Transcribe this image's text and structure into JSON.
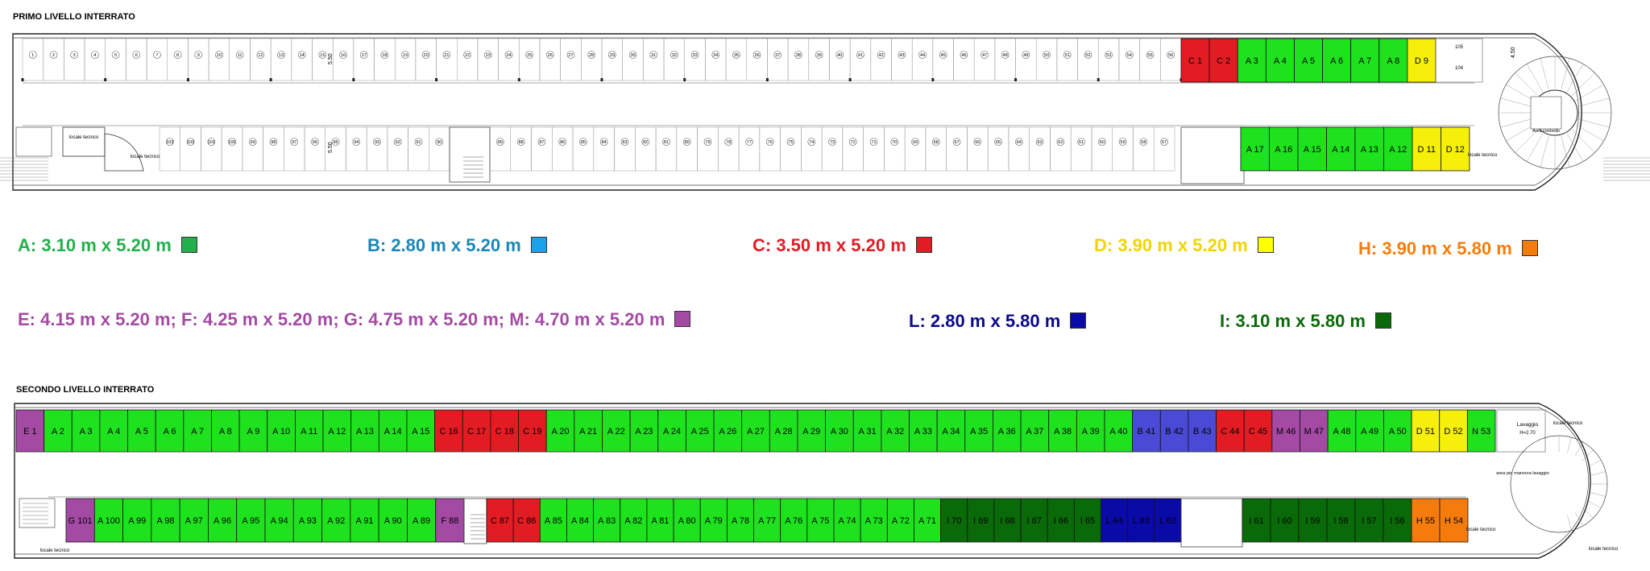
{
  "levels": {
    "first": {
      "title": "PRIMO LIVELLO INTERRATO"
    },
    "second": {
      "title": "SECONDO LIVELLO INTERRATO"
    }
  },
  "colors": {
    "A": "#1fe21f",
    "B": "#4a4ad6",
    "C": "#e31b23",
    "D": "#f5ef0a",
    "H": "#f57c0c",
    "M": "#a44aa4",
    "L": "#0a0aa6",
    "I": "#0a6a0a"
  },
  "legend": {
    "row1": [
      {
        "text": "A:  3.10 m  x  5.20 m",
        "color": "#22b04c",
        "swatch": "#22b04c"
      },
      {
        "text": "B:  2.80 m  x   5.20 m",
        "color": "#1a86b8",
        "swatch": "#1aa3e8"
      },
      {
        "text": "C:  3.50 m  x  5.20 m",
        "color": "#e31b23",
        "swatch": "#e31b23"
      },
      {
        "text": "D:  3.90 m x 5.20 m",
        "color": "#f2d400",
        "swatch": "#ffff00"
      },
      {
        "text": "H: 3.90 m  x  5.80 m",
        "color": "#f57c0c",
        "swatch": "#f57c0c"
      }
    ],
    "row2": [
      {
        "text": "E:  4.15 m  x  5.20 m;  F: 4.25 m  x  5.20 m;  G:  4.75 m  x  5.20 m;  M:  4.70 m  x  5.20 m",
        "color": "#a44aa4",
        "swatch": "#a44aa4"
      },
      {
        "text": "L:  2.80 m  x  5.80 m",
        "color": "#0a0a8a",
        "swatch": "#0a0aa6"
      },
      {
        "text": "I:  3.10 m  x  5.80 m",
        "color": "#0a6a0a",
        "swatch": "#0a6a0a"
      }
    ]
  },
  "level1": {
    "top_numbers": [
      "1",
      "2",
      "3",
      "4",
      "5",
      "6",
      "7",
      "8",
      "9",
      "10",
      "11",
      "12",
      "13",
      "14",
      "15",
      "16",
      "17",
      "18",
      "19",
      "20",
      "21",
      "22",
      "23",
      "24",
      "25",
      "26",
      "27",
      "28",
      "29",
      "30",
      "31",
      "32",
      "33",
      "34",
      "35",
      "36",
      "37",
      "38",
      "39",
      "40",
      "41",
      "42",
      "43",
      "44",
      "45",
      "46",
      "47",
      "48",
      "49",
      "50",
      "51",
      "52",
      "53",
      "54",
      "55",
      "56"
    ],
    "bottom_left_numbers": [
      "103",
      "102",
      "101",
      "100",
      "99",
      "98",
      "97",
      "96",
      "95",
      "94",
      "93",
      "92",
      "91",
      "90"
    ],
    "bottom_right_numbers": [
      "89",
      "88",
      "87",
      "86",
      "85",
      "84",
      "83",
      "82",
      "81",
      "80",
      "79",
      "78",
      "77",
      "76",
      "75",
      "74",
      "73",
      "72",
      "71",
      "70",
      "69",
      "68",
      "67",
      "66",
      "65",
      "64",
      "63",
      "62",
      "61",
      "60",
      "59",
      "58",
      "57"
    ],
    "top_colored": [
      {
        "label": "C 1",
        "type": "C"
      },
      {
        "label": "C 2",
        "type": "C"
      },
      {
        "label": "A 3",
        "type": "A"
      },
      {
        "label": "A 4",
        "type": "A"
      },
      {
        "label": "A 5",
        "type": "A"
      },
      {
        "label": "A 6",
        "type": "A"
      },
      {
        "label": "A 7",
        "type": "A"
      },
      {
        "label": "A 8",
        "type": "A"
      },
      {
        "label": "D 9",
        "type": "D"
      }
    ],
    "bottom_colored": [
      {
        "label": "A 17",
        "type": "A"
      },
      {
        "label": "A 16",
        "type": "A"
      },
      {
        "label": "A 15",
        "type": "A"
      },
      {
        "label": "A 14",
        "type": "A"
      },
      {
        "label": "A 13",
        "type": "A"
      },
      {
        "label": "A 12",
        "type": "A"
      },
      {
        "label": "D 11",
        "type": "D"
      },
      {
        "label": "D 12",
        "type": "D"
      }
    ],
    "locale_tecnico": "locale tecnico",
    "area_controllo": "Area controllo",
    "dim_small": "5.50",
    "dim_ramp": "4.50",
    "small_rooms": [
      "105",
      "104"
    ]
  },
  "level2": {
    "top": [
      {
        "label": "E 1",
        "type": "M"
      },
      {
        "label": "A 2",
        "type": "A"
      },
      {
        "label": "A 3",
        "type": "A"
      },
      {
        "label": "A 4",
        "type": "A"
      },
      {
        "label": "A 5",
        "type": "A"
      },
      {
        "label": "A 6",
        "type": "A"
      },
      {
        "label": "A 7",
        "type": "A"
      },
      {
        "label": "A 8",
        "type": "A"
      },
      {
        "label": "A 9",
        "type": "A"
      },
      {
        "label": "A 10",
        "type": "A"
      },
      {
        "label": "A 11",
        "type": "A"
      },
      {
        "label": "A 12",
        "type": "A"
      },
      {
        "label": "A 13",
        "type": "A"
      },
      {
        "label": "A 14",
        "type": "A"
      },
      {
        "label": "A 15",
        "type": "A"
      },
      {
        "label": "C 16",
        "type": "C"
      },
      {
        "label": "C 17",
        "type": "C"
      },
      {
        "label": "C 18",
        "type": "C"
      },
      {
        "label": "C 19",
        "type": "C"
      },
      {
        "label": "A 20",
        "type": "A"
      },
      {
        "label": "A 21",
        "type": "A"
      },
      {
        "label": "A 22",
        "type": "A"
      },
      {
        "label": "A 23",
        "type": "A"
      },
      {
        "label": "A 24",
        "type": "A"
      },
      {
        "label": "A 25",
        "type": "A"
      },
      {
        "label": "A 26",
        "type": "A"
      },
      {
        "label": "A 27",
        "type": "A"
      },
      {
        "label": "A 28",
        "type": "A"
      },
      {
        "label": "A 29",
        "type": "A"
      },
      {
        "label": "A 30",
        "type": "A"
      },
      {
        "label": "A 31",
        "type": "A"
      },
      {
        "label": "A 32",
        "type": "A"
      },
      {
        "label": "A 33",
        "type": "A"
      },
      {
        "label": "A 34",
        "type": "A"
      },
      {
        "label": "A 35",
        "type": "A"
      },
      {
        "label": "A 36",
        "type": "A"
      },
      {
        "label": "A 37",
        "type": "A"
      },
      {
        "label": "A 38",
        "type": "A"
      },
      {
        "label": "A 39",
        "type": "A"
      },
      {
        "label": "A 40",
        "type": "A"
      },
      {
        "label": "B 41",
        "type": "B"
      },
      {
        "label": "B 42",
        "type": "B"
      },
      {
        "label": "B 43",
        "type": "B"
      },
      {
        "label": "C 44",
        "type": "C"
      },
      {
        "label": "C 45",
        "type": "C"
      },
      {
        "label": "M 46",
        "type": "M"
      },
      {
        "label": "M 47",
        "type": "M"
      },
      {
        "label": "A 48",
        "type": "A"
      },
      {
        "label": "A 49",
        "type": "A"
      },
      {
        "label": "A 50",
        "type": "A"
      },
      {
        "label": "D 51",
        "type": "D"
      },
      {
        "label": "D 52",
        "type": "D"
      },
      {
        "label": "N 53",
        "type": "A"
      }
    ],
    "bottom_left": [
      {
        "label": "G 101",
        "type": "M"
      },
      {
        "label": "A 100",
        "type": "A"
      },
      {
        "label": "A 99",
        "type": "A"
      },
      {
        "label": "A 98",
        "type": "A"
      },
      {
        "label": "A 97",
        "type": "A"
      },
      {
        "label": "A 96",
        "type": "A"
      },
      {
        "label": "A 95",
        "type": "A"
      },
      {
        "label": "A 94",
        "type": "A"
      },
      {
        "label": "A 93",
        "type": "A"
      },
      {
        "label": "A 92",
        "type": "A"
      },
      {
        "label": "A 91",
        "type": "A"
      },
      {
        "label": "A 90",
        "type": "A"
      },
      {
        "label": "A 89",
        "type": "A"
      },
      {
        "label": "F 88",
        "type": "M"
      }
    ],
    "bottom_mid": [
      {
        "label": "C 87",
        "type": "C"
      },
      {
        "label": "C 86",
        "type": "C"
      },
      {
        "label": "A 85",
        "type": "A"
      },
      {
        "label": "A 84",
        "type": "A"
      },
      {
        "label": "A 83",
        "type": "A"
      },
      {
        "label": "A 82",
        "type": "A"
      },
      {
        "label": "A 81",
        "type": "A"
      },
      {
        "label": "A 80",
        "type": "A"
      },
      {
        "label": "A 79",
        "type": "A"
      },
      {
        "label": "A 78",
        "type": "A"
      },
      {
        "label": "A 77",
        "type": "A"
      },
      {
        "label": "A 76",
        "type": "A"
      },
      {
        "label": "A 75",
        "type": "A"
      },
      {
        "label": "A 74",
        "type": "A"
      },
      {
        "label": "A 73",
        "type": "A"
      },
      {
        "label": "A 72",
        "type": "A"
      },
      {
        "label": "A 71",
        "type": "A"
      },
      {
        "label": "I 70",
        "type": "I"
      },
      {
        "label": "I 69",
        "type": "I"
      },
      {
        "label": "I 68",
        "type": "I"
      },
      {
        "label": "I 67",
        "type": "I"
      },
      {
        "label": "I 66",
        "type": "I"
      },
      {
        "label": "I 65",
        "type": "I"
      },
      {
        "label": "L 64",
        "type": "L"
      },
      {
        "label": "L 63",
        "type": "L"
      },
      {
        "label": "L 62",
        "type": "L"
      }
    ],
    "bottom_right": [
      {
        "label": "I 61",
        "type": "I"
      },
      {
        "label": "I 60",
        "type": "I"
      },
      {
        "label": "I 59",
        "type": "I"
      },
      {
        "label": "I 58",
        "type": "I"
      },
      {
        "label": "I 57",
        "type": "I"
      },
      {
        "label": "I 56",
        "type": "I"
      },
      {
        "label": "H 55",
        "type": "H"
      },
      {
        "label": "H 54",
        "type": "H"
      }
    ],
    "lavaggio": "Lavaggio",
    "lavaggio_h": "H=2.70",
    "area_manovra": "area per manovra lavaggio",
    "locale_tecnico": "locale tecnico"
  }
}
